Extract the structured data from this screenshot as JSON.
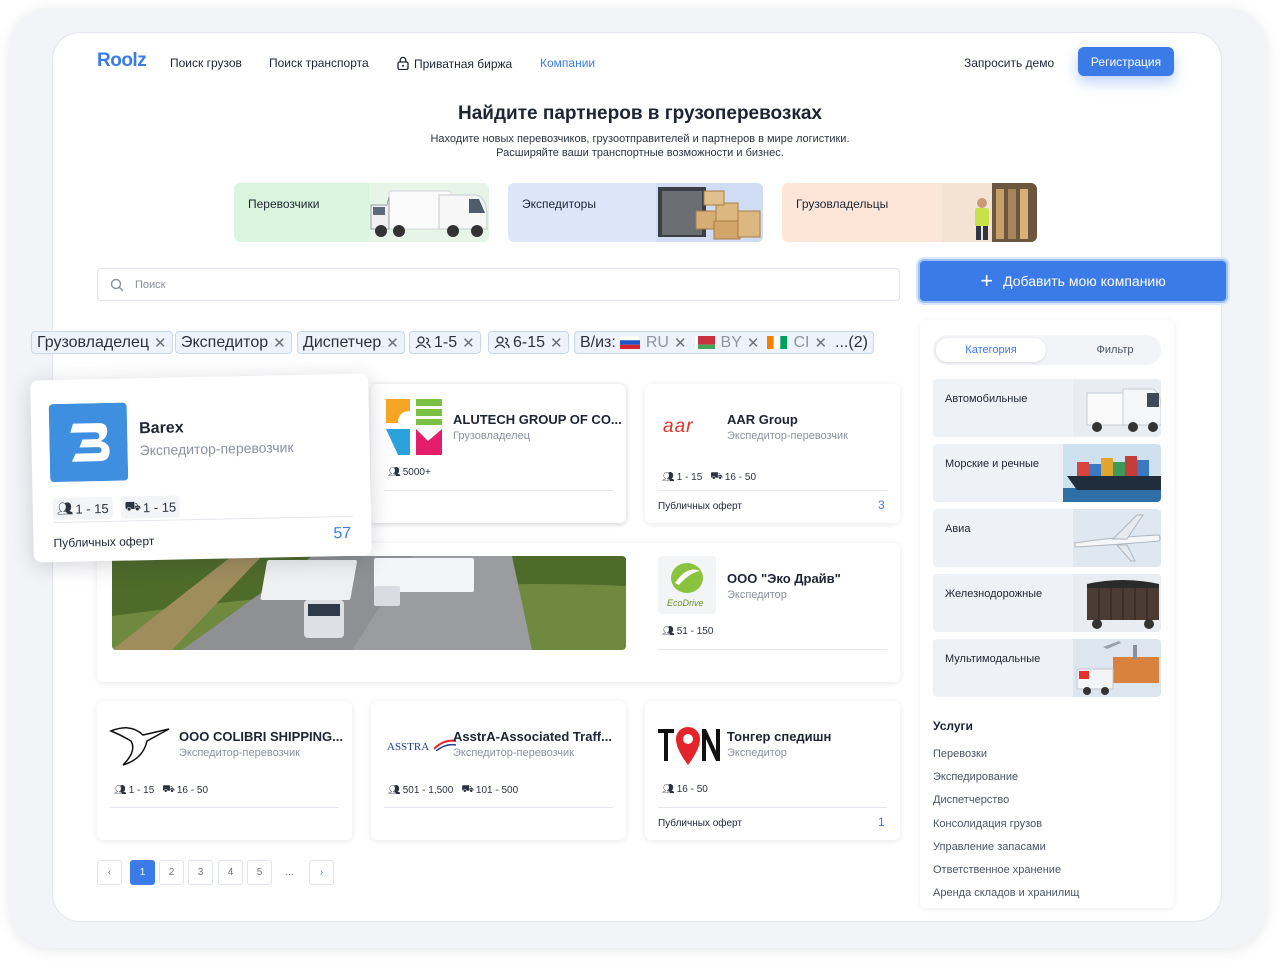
{
  "nav": {
    "logo": "Roolz",
    "items": [
      "Поиск грузов",
      "Поиск транспорта",
      "Приватная биржа",
      "Компании"
    ],
    "demo": "Запросить демо",
    "register": "Регистрация"
  },
  "hero": {
    "title": "Найдите партнеров в грузоперевозках",
    "sub1": "Находите новых перевозчиков, грузоотправителей и партнеров в мире логистики.",
    "sub2": "Расширяйте ваши транспортные возможности и бизнес."
  },
  "categories": [
    "Перевозчики",
    "Экспедиторы",
    "Грузовладельцы"
  ],
  "search": {
    "placeholder": "Поиск"
  },
  "add_company": "Добавить мою компанию",
  "chips": {
    "owner": "Грузовладелец",
    "forwarder": "Экспедитор",
    "dispatcher": "Диспетчер",
    "size1": "1-5",
    "size2": "6-15",
    "route_label": "В/из:",
    "ru": "RU",
    "by": "BY",
    "ci": "CI",
    "more": "...(2)"
  },
  "companies": {
    "barex": {
      "name": "Barex",
      "type": "Экспедитор-перевозчик",
      "emp": "1 - 15",
      "trucks": "1 - 15",
      "offers_label": "Публичных оферт",
      "offers": "57"
    },
    "alutech": {
      "name": "ALUTECH GROUP OF CO...",
      "type": "Грузовладелец",
      "emp": "5000+"
    },
    "aar": {
      "name": "AAR Group",
      "type": "Экспедитор-перевозчик",
      "emp": "1 - 15",
      "trucks": "16 - 50",
      "offers_label": "Публичных оферт",
      "offers": "3",
      "logo": "aar"
    },
    "eco": {
      "name": "ООО \"Эко Драйв\"",
      "type": "Экспедитор",
      "emp": "51 - 150",
      "logo": "EcoDrive"
    },
    "colibri": {
      "name": "ООО COLIBRI SHIPPING...",
      "type": "Экспедитор-перевозчик",
      "emp": "1 - 15",
      "trucks": "16 - 50"
    },
    "asstra": {
      "name": "AsstrA-Associated Traff...",
      "type": "Экспедитор-перевозчик",
      "emp": "501 - 1,500",
      "trucks": "101 - 500",
      "logo": "ASSTRA"
    },
    "tonger": {
      "name": "Тонгер спедишн",
      "type": "Экспедитор",
      "emp": "16 - 50",
      "offers_label": "Публичных оферт",
      "offers": "1"
    }
  },
  "panel": {
    "tab_category": "Категория",
    "tab_filter": "Фильтр",
    "transport": [
      "Автомобильные",
      "Морские и речные",
      "Авиа",
      "Железнодорожные",
      "Мультимодальные"
    ],
    "services_title": "Услуги",
    "services": [
      "Перевозки",
      "Экспедирование",
      "Диспетчерство",
      "Консолидация грузов",
      "Управление запасами",
      "Ответственное хранение",
      "Аренда складов и хранилищ"
    ]
  },
  "pagination": {
    "prev": "‹",
    "pages": [
      "1",
      "2",
      "3",
      "4",
      "5"
    ],
    "ellipsis": "...",
    "next": "›"
  },
  "colors": {
    "accent": "#3b7be8",
    "text": "#1d2433"
  }
}
